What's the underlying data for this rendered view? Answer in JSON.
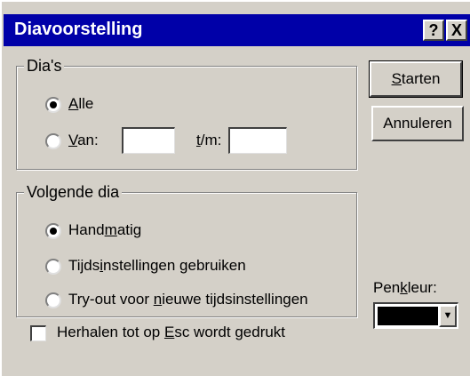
{
  "window": {
    "title": "Diavoorstelling",
    "help_label": "?",
    "close_label": "X"
  },
  "dias_group": {
    "label": "Dia's",
    "all": {
      "before": "",
      "key": "A",
      "after": "lle",
      "selected": true
    },
    "range": {
      "before": "",
      "key": "V",
      "after": "an:",
      "selected": false
    },
    "from_value": "",
    "to_label": {
      "before": "",
      "key": "t",
      "after": "/m:"
    },
    "to_value": ""
  },
  "next_group": {
    "label": "Volgende dia",
    "options": [
      {
        "before": "Hand",
        "key": "m",
        "after": "atig",
        "selected": true
      },
      {
        "before": "Tijds",
        "key": "i",
        "after": "nstellingen gebruiken",
        "selected": false
      },
      {
        "before": "Try-out voor ",
        "key": "n",
        "after": "ieuwe tijdsinstellingen",
        "selected": false
      }
    ]
  },
  "buttons": {
    "start": {
      "before": "",
      "key": "S",
      "after": "tarten"
    },
    "cancel": "Annuleren"
  },
  "pen": {
    "label": {
      "before": "Pen",
      "key": "k",
      "after": "leur:"
    },
    "color": "#000000"
  },
  "repeat": {
    "before": "Herhalen tot op ",
    "key": "E",
    "after": "sc wordt gedrukt",
    "checked": false
  }
}
